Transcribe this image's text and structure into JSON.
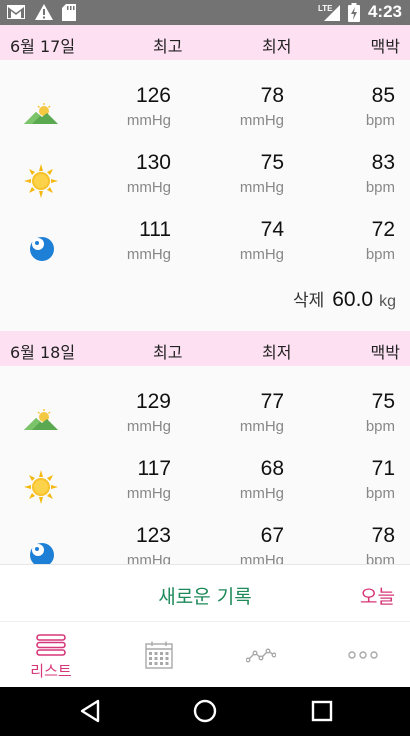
{
  "status_bar": {
    "time": "4:23",
    "network_label": "LTE",
    "icons": [
      "gmail-icon",
      "warning-icon",
      "sd-card-icon",
      "signal-icon",
      "battery-charging-icon"
    ]
  },
  "header_labels": {
    "max": "최고",
    "min": "최저",
    "pulse": "맥박"
  },
  "days": [
    {
      "date": "6월 17일",
      "readings": [
        {
          "icon": "morning-mountain-icon",
          "max": "126",
          "min": "78",
          "pulse": "85",
          "bp_unit": "mmHg",
          "pulse_unit": "bpm"
        },
        {
          "icon": "sun-icon",
          "max": "130",
          "min": "75",
          "pulse": "83",
          "bp_unit": "mmHg",
          "pulse_unit": "bpm"
        },
        {
          "icon": "moon-icon",
          "max": "111",
          "min": "74",
          "pulse": "72",
          "bp_unit": "mmHg",
          "pulse_unit": "bpm"
        }
      ],
      "weight_label": "삭제",
      "weight_value": "60.0",
      "weight_unit": "kg"
    },
    {
      "date": "6월 18일",
      "readings": [
        {
          "icon": "morning-mountain-icon",
          "max": "129",
          "min": "77",
          "pulse": "75",
          "bp_unit": "mmHg",
          "pulse_unit": "bpm"
        },
        {
          "icon": "sun-icon",
          "max": "117",
          "min": "68",
          "pulse": "71",
          "bp_unit": "mmHg",
          "pulse_unit": "bpm"
        },
        {
          "icon": "moon-icon",
          "max": "123",
          "min": "67",
          "pulse": "78",
          "bp_unit": "mmHg",
          "pulse_unit": "bpm"
        }
      ]
    }
  ],
  "action_bar": {
    "new_record": "새로운 기록",
    "today": "오늘"
  },
  "tabs": [
    {
      "label": "리스트",
      "icon": "list-icon",
      "active": true
    },
    {
      "label": "",
      "icon": "calendar-icon",
      "active": false
    },
    {
      "label": "",
      "icon": "graph-icon",
      "active": false
    },
    {
      "label": "",
      "icon": "more-icon",
      "active": false
    }
  ],
  "colors": {
    "accent_pink": "#d63779",
    "accent_green": "#1f8a5a",
    "header_bg": "#fde0f2",
    "status_bar_bg": "#737373"
  }
}
